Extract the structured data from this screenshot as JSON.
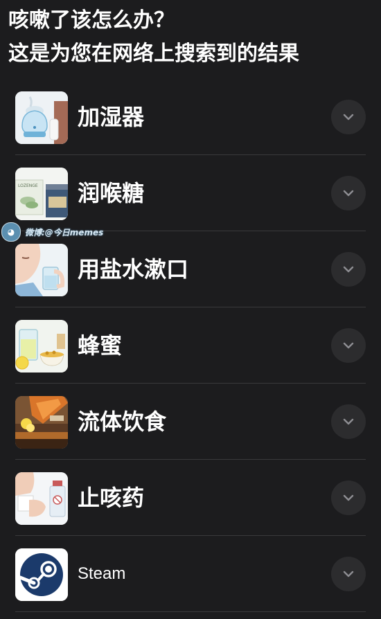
{
  "header": {
    "line1": "咳嗽了该怎么办？",
    "line2": "这是为您在网络上搜索到的结果"
  },
  "watermark": {
    "text": "微博:@今日memes",
    "logo_icon": "sleepy-face-logo"
  },
  "items": [
    {
      "label": "加湿器",
      "thumb_icon": "humidifier-image",
      "expand_icon": "chevron-down-icon"
    },
    {
      "label": "润喉糖",
      "thumb_icon": "lozenge-jar-image",
      "thumb_text": "LOZENGE",
      "expand_icon": "chevron-down-icon"
    },
    {
      "label": "用盐水漱口",
      "thumb_icon": "gargle-saltwater-image",
      "expand_icon": "chevron-down-icon"
    },
    {
      "label": "蜂蜜",
      "thumb_icon": "honey-lemon-image",
      "expand_icon": "chevron-down-icon"
    },
    {
      "label": "流体饮食",
      "thumb_icon": "liquid-food-image",
      "expand_icon": "chevron-down-icon"
    },
    {
      "label": "止咳药",
      "thumb_icon": "cough-medicine-image",
      "expand_icon": "chevron-down-icon"
    },
    {
      "label": "Steam",
      "thumb_icon": "steam-logo",
      "expand_icon": "chevron-down-icon"
    }
  ],
  "colors": {
    "background": "#1c1c1e",
    "divider": "#3a3a3c",
    "button_bg": "#2c2c2e",
    "text": "#ffffff",
    "steam_blue": "#1b3a6b"
  }
}
